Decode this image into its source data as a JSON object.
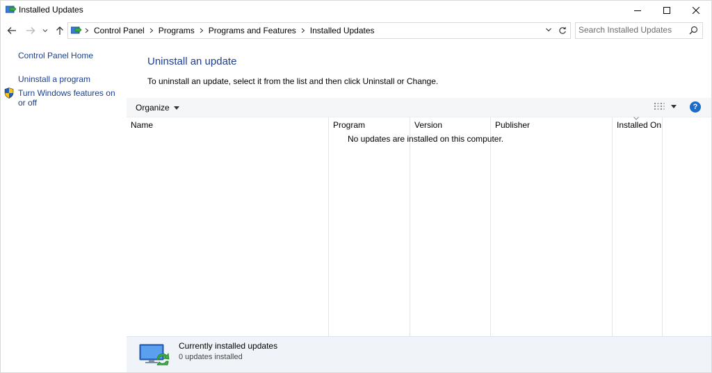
{
  "window": {
    "title": "Installed Updates"
  },
  "address": {
    "crumbs": [
      "Control Panel",
      "Programs",
      "Programs and Features",
      "Installed Updates"
    ]
  },
  "search": {
    "placeholder": "Search Installed Updates"
  },
  "sidebar": {
    "home": "Control Panel Home",
    "uninstall_program": "Uninstall a program",
    "windows_features": "Turn Windows features on or off"
  },
  "main": {
    "heading": "Uninstall an update",
    "instructions": "To uninstall an update, select it from the list and then click Uninstall or Change."
  },
  "toolbar": {
    "organize": "Organize",
    "help": "?"
  },
  "list": {
    "columns": [
      "Name",
      "Program",
      "Version",
      "Publisher",
      "Installed On"
    ],
    "empty_message": "No updates are installed on this computer."
  },
  "details": {
    "title": "Currently installed updates",
    "count_text": "0 updates installed"
  },
  "colors": {
    "link": "#1a3e8c",
    "heading": "#1e3d8f",
    "details_bg": "#f0f4f9",
    "help_blue": "#1a6cc8"
  },
  "icons": [
    "control-panel-icon",
    "minimize-icon",
    "maximize-icon",
    "close-icon",
    "back-arrow-icon",
    "forward-arrow-icon",
    "recent-chevron-icon",
    "up-arrow-icon",
    "chevron-right-icon",
    "dropdown-icon",
    "refresh-icon",
    "search-icon",
    "shield-icon",
    "view-options-icon",
    "help-icon",
    "updates-monitor-icon"
  ]
}
